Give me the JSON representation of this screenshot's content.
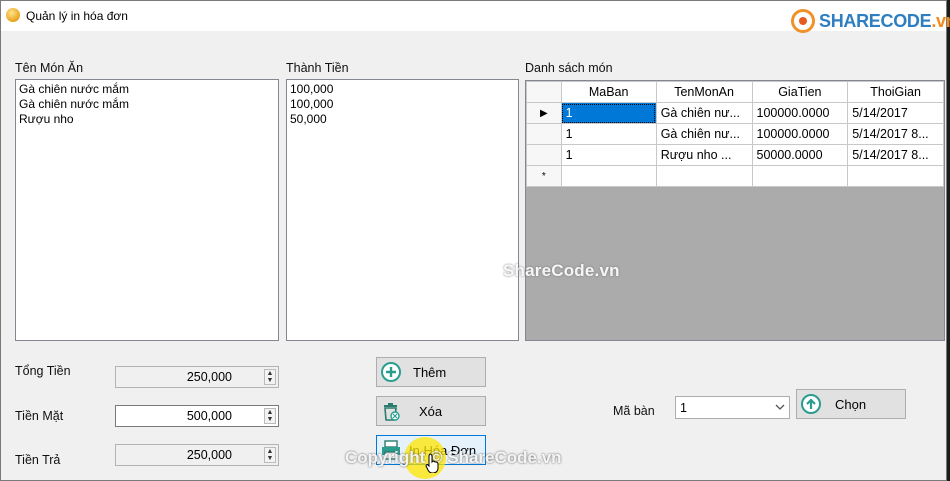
{
  "window": {
    "title": "Quản lý in hóa đơn"
  },
  "logo": {
    "brand": "SHARECODE",
    "suffix": ".vn"
  },
  "labels": {
    "ten_mon_an": "Tên Món Ăn",
    "thanh_tien": "Thành Tiền",
    "danh_sach_mon": "Danh sách món",
    "tong_tien": "Tổng Tiền",
    "tien_mat": "Tiền Mặt",
    "tien_tra": "Tiền Trả",
    "ma_ban": "Mã bàn"
  },
  "list_ten_mon": [
    "Gà chiên nước mắm",
    "Gà chiên nước mắm",
    "Rượu nho"
  ],
  "list_thanh_tien": [
    "100,000",
    "100,000",
    "50,000"
  ],
  "grid": {
    "columns": [
      "MaBan",
      "TenMonAn",
      "GiaTien",
      "ThoiGian"
    ],
    "rows": [
      {
        "MaBan": "1",
        "TenMonAn": "Gà chiên nư...",
        "GiaTien": "100000.0000",
        "ThoiGian": "5/14/2017"
      },
      {
        "MaBan": "1",
        "TenMonAn": "Gà chiên nư...",
        "GiaTien": "100000.0000",
        "ThoiGian": "5/14/2017 8..."
      },
      {
        "MaBan": "1",
        "TenMonAn": "Rượu nho     ...",
        "GiaTien": "50000.0000",
        "ThoiGian": "5/14/2017 8..."
      }
    ],
    "current_row_marker": "▶",
    "new_row_marker": "*"
  },
  "fields": {
    "tong_tien": "250,000",
    "tien_mat": "500,000",
    "tien_tra": "250,000"
  },
  "buttons": {
    "them": "Thêm",
    "xoa": "Xóa",
    "in_hoa_don": "In Hóa Đơn",
    "chon": "Chọn"
  },
  "combo": {
    "ma_ban_value": "1"
  },
  "watermarks": {
    "center": "ShareCode.vn",
    "bottom": "Copyright © ShareCode.vn"
  },
  "colors": {
    "selection": "#0078d7",
    "grid_background": "#ababab",
    "accent_green": "#2a9d8f"
  }
}
